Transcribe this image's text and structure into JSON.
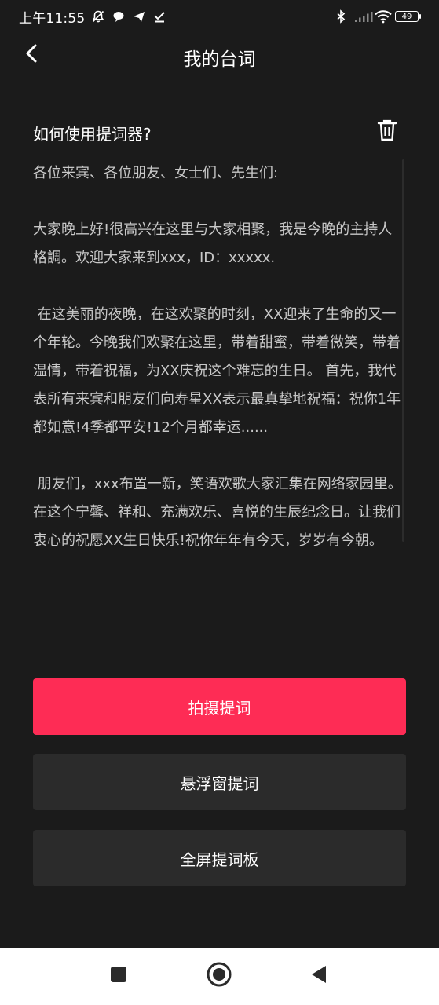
{
  "status_bar": {
    "time": "上午11:55",
    "battery": "49"
  },
  "header": {
    "title": "我的台词"
  },
  "script": {
    "heading": "如何使用提词器?",
    "content": "各位来宾、各位朋友、女士们、先生们:\n\n大家晚上好!很高兴在这里与大家相聚，我是今晚的主持人格調。欢迎大家来到xxx，ID：xxxxx.\n\n 在这美丽的夜晚，在这欢聚的时刻，XX迎来了生命的又一个年轮。今晚我们欢聚在这里，带着甜蜜，带着微笑，带着温情，带着祝福，为XX庆祝这个难忘的生日。 首先，我代表所有来宾和朋友们向寿星XX表示最真挚地祝福：祝你1年都如意!4季都平安!12个月都幸运......\n\n 朋友们，xxx布置一新，笑语欢歌大家汇集在网络家园里。在这个宁馨、祥和、充满欢乐、喜悦的生辰纪念日。让我们衷心的祝愿XX生日快乐!祝你年年有今天，岁岁有今朝。"
  },
  "buttons": {
    "shoot": "拍摄提词",
    "floating": "悬浮窗提词",
    "fullscreen": "全屏提词板"
  },
  "colors": {
    "accent": "#fe2c55",
    "background": "#1b1b1b",
    "secondary_button": "#2b2b2b",
    "body_text": "#c8c8c8"
  },
  "icons": {
    "back": "chevron-left-icon",
    "delete": "trash-icon",
    "nav_recent": "square-icon",
    "nav_home": "circle-icon",
    "nav_back": "triangle-icon"
  }
}
